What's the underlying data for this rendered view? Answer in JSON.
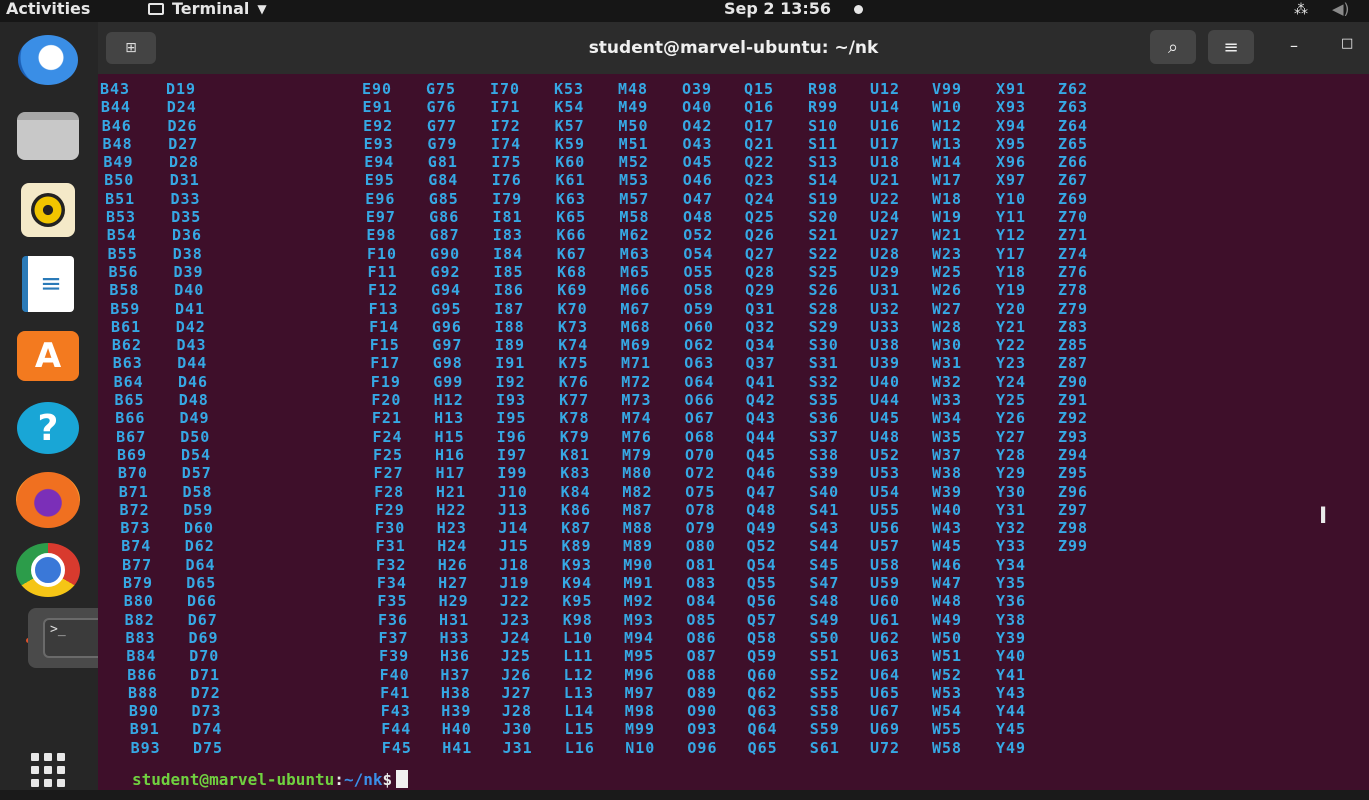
{
  "topbar": {
    "activities": "Activities",
    "app_name": "Terminal",
    "datetime": "Sep 2  13:56"
  },
  "dock": {
    "apps": [
      {
        "name": "thunderbird",
        "icon": "thunderbird-icon"
      },
      {
        "name": "files",
        "icon": "files-icon"
      },
      {
        "name": "rhythmbox",
        "icon": "rhythmbox-icon"
      },
      {
        "name": "libreoffice-writer",
        "icon": "writer-icon"
      },
      {
        "name": "ubuntu-software",
        "icon": "store-icon",
        "glyph": "A"
      },
      {
        "name": "help",
        "icon": "help-icon",
        "glyph": "?"
      },
      {
        "name": "firefox",
        "icon": "firefox-icon"
      },
      {
        "name": "chrome",
        "icon": "chrome-icon"
      },
      {
        "name": "terminal",
        "icon": "terminal-icon",
        "glyph": ">_"
      },
      {
        "name": "show-applications",
        "icon": "grid-icon"
      }
    ]
  },
  "window": {
    "title": "student@marvel-ubuntu: ~/nk",
    "minimize": "–",
    "maximize": "□"
  },
  "terminal": {
    "columns": [
      [
        "B43",
        "B44",
        "B46",
        "B48",
        "B49",
        "B50",
        "B51",
        "B53",
        "B54",
        "B55",
        "B56",
        "B58",
        "B59",
        "B61",
        "B62",
        "B63",
        "B64",
        "B65",
        "B66",
        "B67",
        "B69",
        "B70",
        "B71",
        "B72",
        "B73",
        "B74",
        "B77",
        "B79",
        "B80",
        "B82",
        "B83",
        "B84",
        "B86",
        "B88",
        "B90",
        "B91",
        "B93"
      ],
      [
        "D19",
        "D24",
        "D26",
        "D27",
        "D28",
        "D31",
        "D33",
        "D35",
        "D36",
        "D38",
        "D39",
        "D40",
        "D41",
        "D42",
        "D43",
        "D44",
        "D46",
        "D48",
        "D49",
        "D50",
        "D54",
        "D57",
        "D58",
        "D59",
        "D60",
        "D62",
        "D64",
        "D65",
        "D66",
        "D67",
        "D69",
        "D70",
        "D71",
        "D72",
        "D73",
        "D74",
        "D75"
      ],
      [
        "E90",
        "E91",
        "E92",
        "E93",
        "E94",
        "E95",
        "E96",
        "E97",
        "E98",
        "F10",
        "F11",
        "F12",
        "F13",
        "F14",
        "F15",
        "F17",
        "F19",
        "F20",
        "F21",
        "F24",
        "F25",
        "F27",
        "F28",
        "F29",
        "F30",
        "F31",
        "F32",
        "F34",
        "F35",
        "F36",
        "F37",
        "F39",
        "F40",
        "F41",
        "F43",
        "F44",
        "F45"
      ],
      [
        "G75",
        "G76",
        "G77",
        "G79",
        "G81",
        "G84",
        "G85",
        "G86",
        "G87",
        "G90",
        "G92",
        "G94",
        "G95",
        "G96",
        "G97",
        "G98",
        "G99",
        "H12",
        "H13",
        "H15",
        "H16",
        "H17",
        "H21",
        "H22",
        "H23",
        "H24",
        "H26",
        "H27",
        "H29",
        "H31",
        "H33",
        "H36",
        "H37",
        "H38",
        "H39",
        "H40",
        "H41"
      ],
      [
        "I70",
        "I71",
        "I72",
        "I74",
        "I75",
        "I76",
        "I79",
        "I81",
        "I83",
        "I84",
        "I85",
        "I86",
        "I87",
        "I88",
        "I89",
        "I91",
        "I92",
        "I93",
        "I95",
        "I96",
        "I97",
        "I99",
        "J10",
        "J13",
        "J14",
        "J15",
        "J18",
        "J19",
        "J22",
        "J23",
        "J24",
        "J25",
        "J26",
        "J27",
        "J28",
        "J30",
        "J31"
      ],
      [
        "K53",
        "K54",
        "K57",
        "K59",
        "K60",
        "K61",
        "K63",
        "K65",
        "K66",
        "K67",
        "K68",
        "K69",
        "K70",
        "K73",
        "K74",
        "K75",
        "K76",
        "K77",
        "K78",
        "K79",
        "K81",
        "K83",
        "K84",
        "K86",
        "K87",
        "K89",
        "K93",
        "K94",
        "K95",
        "K98",
        "L10",
        "L11",
        "L12",
        "L13",
        "L14",
        "L15",
        "L16"
      ],
      [
        "M48",
        "M49",
        "M50",
        "M51",
        "M52",
        "M53",
        "M57",
        "M58",
        "M62",
        "M63",
        "M65",
        "M66",
        "M67",
        "M68",
        "M69",
        "M71",
        "M72",
        "M73",
        "M74",
        "M76",
        "M79",
        "M80",
        "M82",
        "M87",
        "M88",
        "M89",
        "M90",
        "M91",
        "M92",
        "M93",
        "M94",
        "M95",
        "M96",
        "M97",
        "M98",
        "M99",
        "N10"
      ],
      [
        "O39",
        "O40",
        "O42",
        "O43",
        "O45",
        "O46",
        "O47",
        "O48",
        "O52",
        "O54",
        "O55",
        "O58",
        "O59",
        "O60",
        "O62",
        "O63",
        "O64",
        "O66",
        "O67",
        "O68",
        "O70",
        "O72",
        "O75",
        "O78",
        "O79",
        "O80",
        "O81",
        "O83",
        "O84",
        "O85",
        "O86",
        "O87",
        "O88",
        "O89",
        "O90",
        "O93",
        "O96"
      ],
      [
        "Q15",
        "Q16",
        "Q17",
        "Q21",
        "Q22",
        "Q23",
        "Q24",
        "Q25",
        "Q26",
        "Q27",
        "Q28",
        "Q29",
        "Q31",
        "Q32",
        "Q34",
        "Q37",
        "Q41",
        "Q42",
        "Q43",
        "Q44",
        "Q45",
        "Q46",
        "Q47",
        "Q48",
        "Q49",
        "Q52",
        "Q54",
        "Q55",
        "Q56",
        "Q57",
        "Q58",
        "Q59",
        "Q60",
        "Q62",
        "Q63",
        "Q64",
        "Q65"
      ],
      [
        "R98",
        "R99",
        "S10",
        "S11",
        "S13",
        "S14",
        "S19",
        "S20",
        "S21",
        "S22",
        "S25",
        "S26",
        "S28",
        "S29",
        "S30",
        "S31",
        "S32",
        "S35",
        "S36",
        "S37",
        "S38",
        "S39",
        "S40",
        "S41",
        "S43",
        "S44",
        "S45",
        "S47",
        "S48",
        "S49",
        "S50",
        "S51",
        "S52",
        "S55",
        "S58",
        "S59",
        "S61"
      ],
      [
        "U12",
        "U14",
        "U16",
        "U17",
        "U18",
        "U21",
        "U22",
        "U24",
        "U27",
        "U28",
        "U29",
        "U31",
        "U32",
        "U33",
        "U38",
        "U39",
        "U40",
        "U44",
        "U45",
        "U48",
        "U52",
        "U53",
        "U54",
        "U55",
        "U56",
        "U57",
        "U58",
        "U59",
        "U60",
        "U61",
        "U62",
        "U63",
        "U64",
        "U65",
        "U67",
        "U69",
        "U72"
      ],
      [
        "V99",
        "W10",
        "W12",
        "W13",
        "W14",
        "W17",
        "W18",
        "W19",
        "W21",
        "W23",
        "W25",
        "W26",
        "W27",
        "W28",
        "W30",
        "W31",
        "W32",
        "W33",
        "W34",
        "W35",
        "W37",
        "W38",
        "W39",
        "W40",
        "W43",
        "W45",
        "W46",
        "W47",
        "W48",
        "W49",
        "W50",
        "W51",
        "W52",
        "W53",
        "W54",
        "W55",
        "W58"
      ],
      [
        "X91",
        "X93",
        "X94",
        "X95",
        "X96",
        "X97",
        "Y10",
        "Y11",
        "Y12",
        "Y17",
        "Y18",
        "Y19",
        "Y20",
        "Y21",
        "Y22",
        "Y23",
        "Y24",
        "Y25",
        "Y26",
        "Y27",
        "Y28",
        "Y29",
        "Y30",
        "Y31",
        "Y32",
        "Y33",
        "Y34",
        "Y35",
        "Y36",
        "Y38",
        "Y39",
        "Y40",
        "Y41",
        "Y43",
        "Y44",
        "Y45",
        "Y49"
      ],
      [
        "Z62",
        "Z63",
        "Z64",
        "Z65",
        "Z66",
        "Z67",
        "Z69",
        "Z70",
        "Z71",
        "Z74",
        "Z76",
        "Z78",
        "Z79",
        "Z83",
        "Z85",
        "Z87",
        "Z90",
        "Z91",
        "Z92",
        "Z93",
        "Z94",
        "Z95",
        "Z96",
        "Z97",
        "Z98",
        "Z99"
      ]
    ],
    "prompt": {
      "user_host": "student@marvel-ubuntu",
      "separator": ":",
      "path": "~/nk",
      "symbol": "$"
    }
  },
  "colors": {
    "terminal_bg": "#3e0f2a",
    "listing_text": "#36a8e4",
    "prompt_user": "#70d040",
    "prompt_path": "#3a8fe8"
  }
}
